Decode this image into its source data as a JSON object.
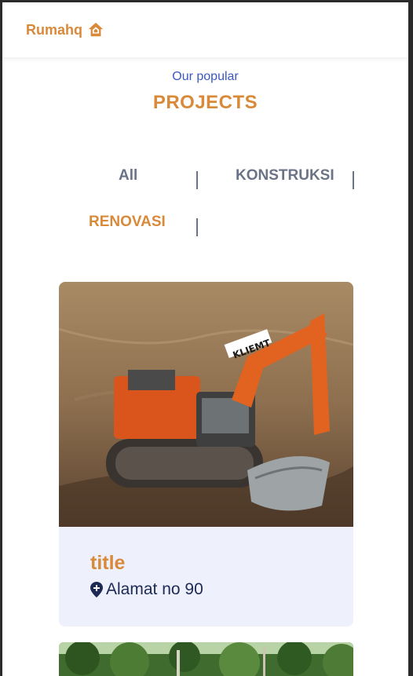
{
  "brand": {
    "name": "Rumahq",
    "color": "#d88a3a",
    "icon": "house-icon"
  },
  "section": {
    "subtitle": "Our popular",
    "title": "PROJECTS"
  },
  "filters": [
    {
      "label": "All",
      "active": false
    },
    {
      "label": "KONSTRUKSI",
      "active": false
    },
    {
      "label": "RENOVASI",
      "active": true
    }
  ],
  "projects": [
    {
      "image": "excavator-photo",
      "title": "title",
      "address": "Alamat no 90",
      "address_icon": "map-pin-icon"
    },
    {
      "image": "forest-photo"
    }
  ],
  "colors": {
    "accent": "#d88a3a",
    "blue": "#3b58c4",
    "navy": "#1c2a55",
    "muted": "#6b7387",
    "card_bg": "#eef0fb"
  }
}
